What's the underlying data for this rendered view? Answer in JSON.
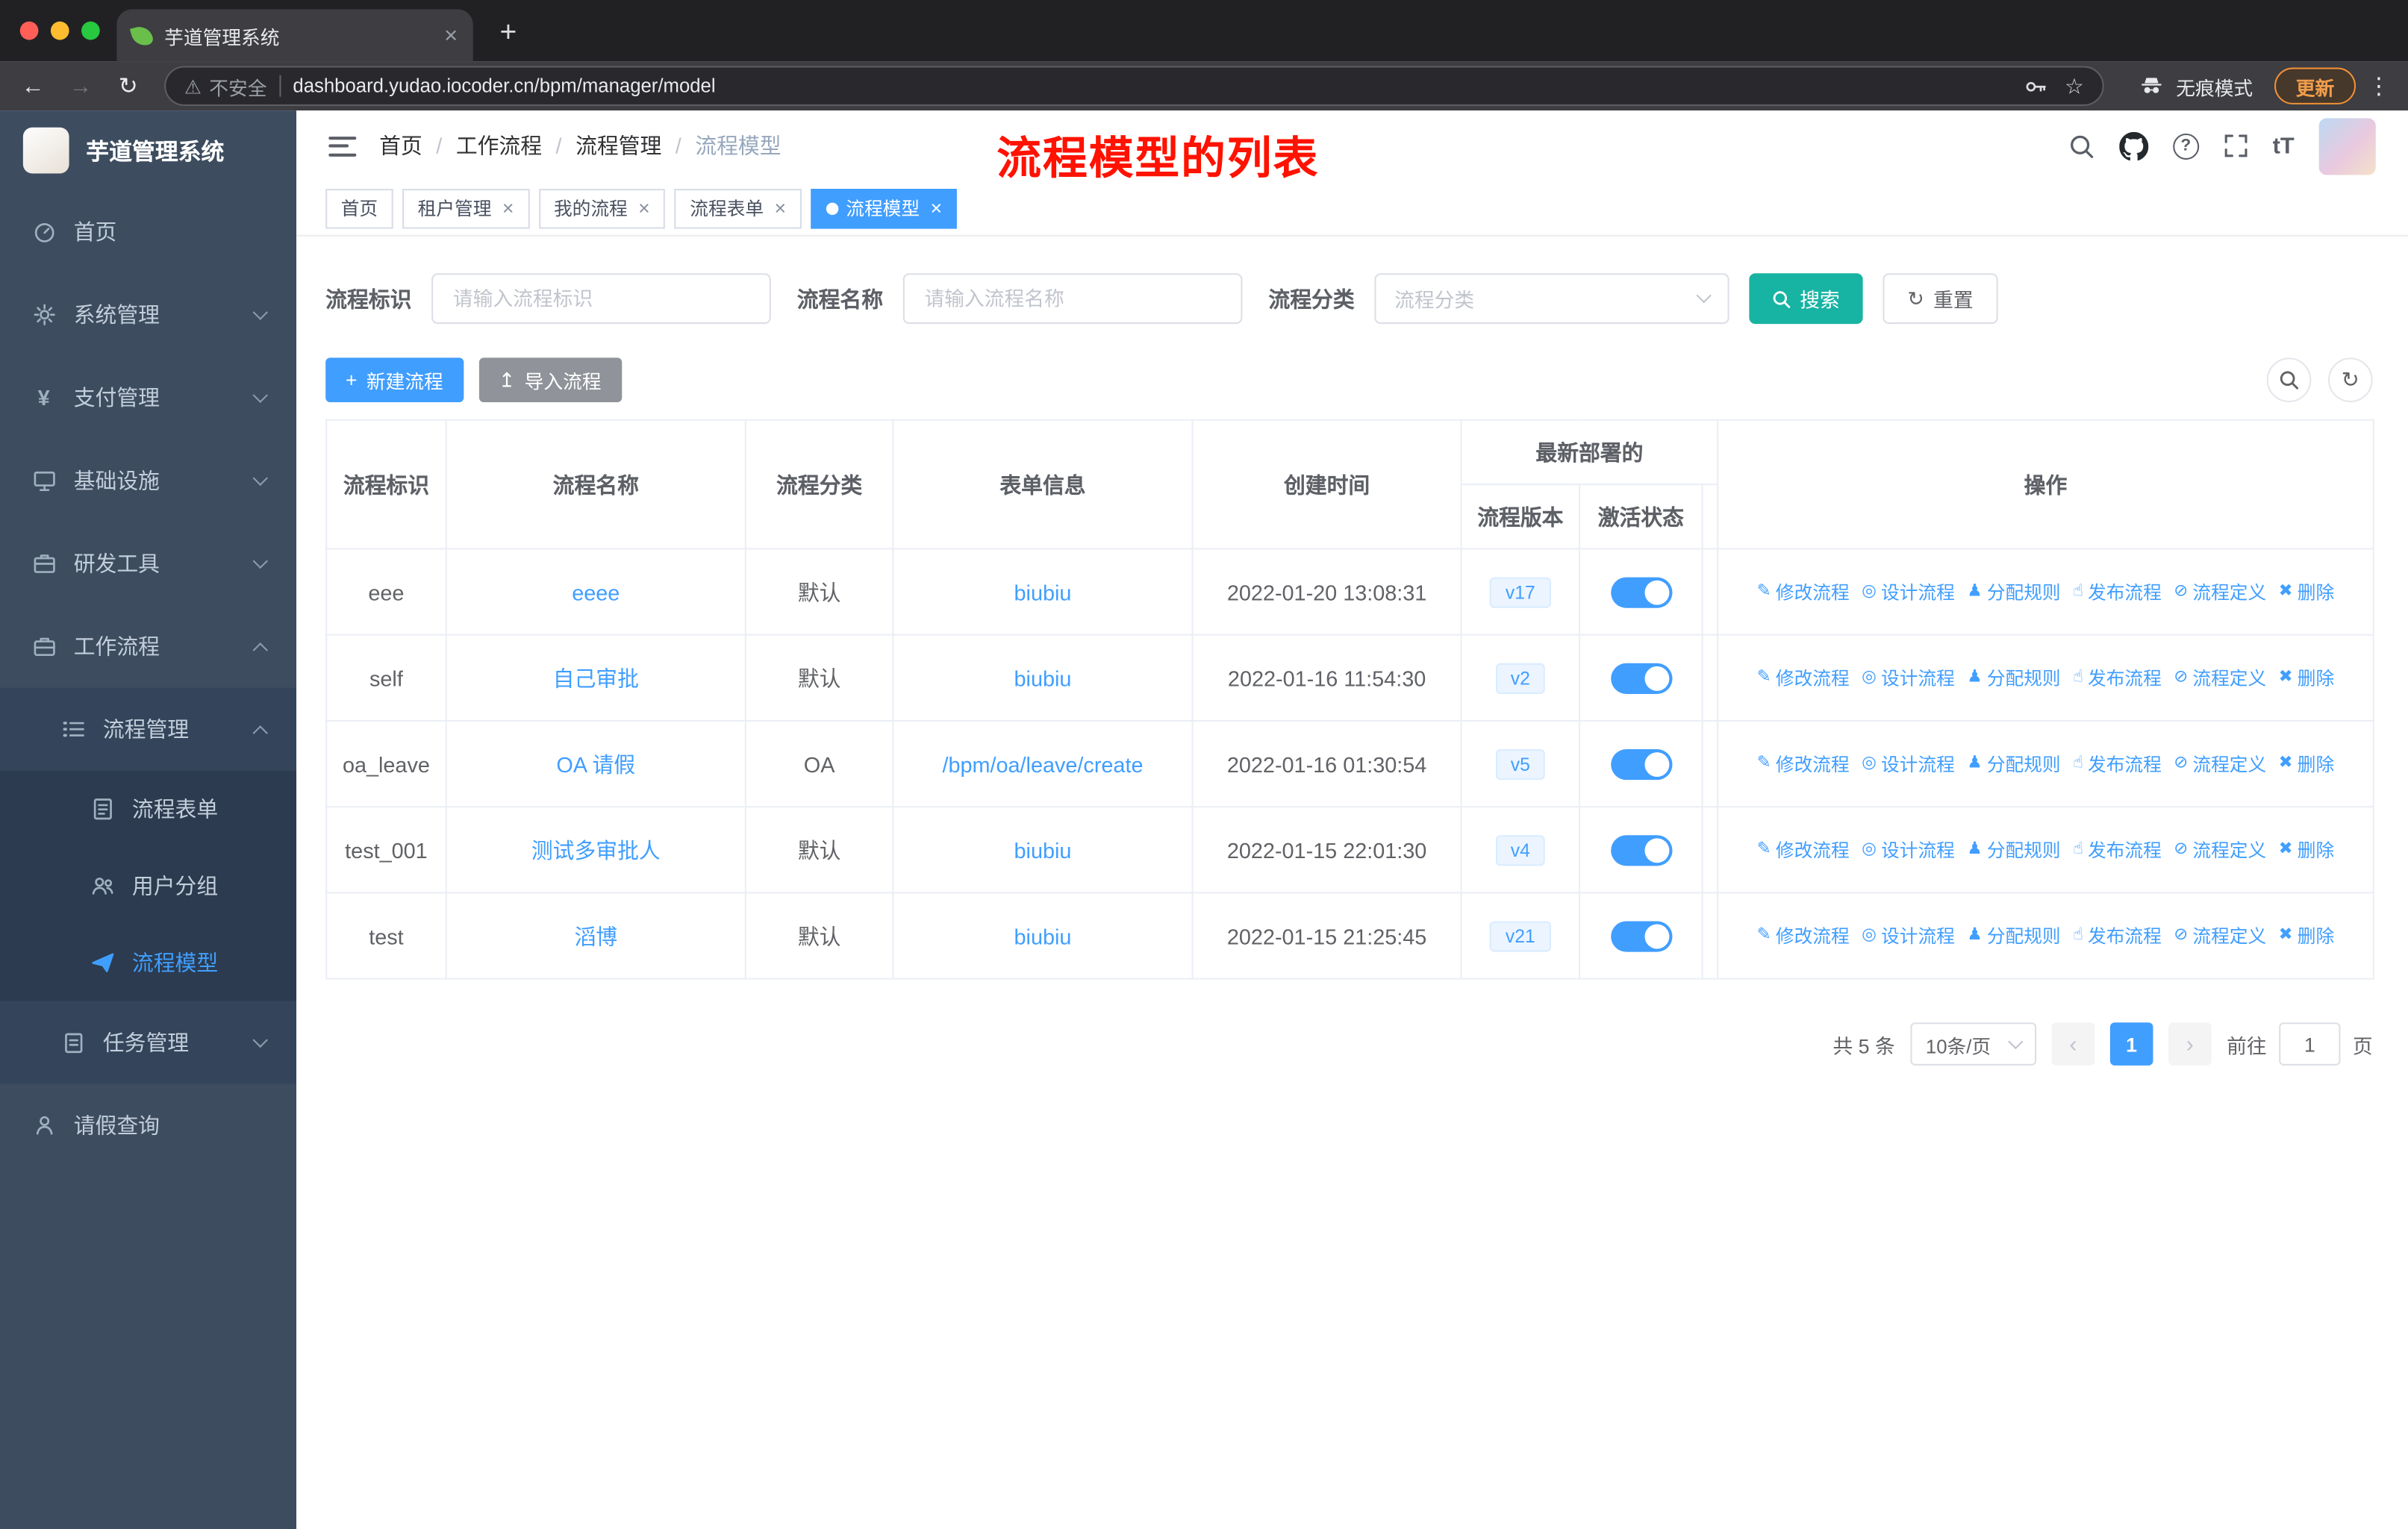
{
  "browser": {
    "tab_title": "芋道管理系统",
    "security_label": "不安全",
    "url": "dashboard.yudao.iocoder.cn/bpm/manager/model",
    "incognito_label": "无痕模式",
    "update_label": "更新"
  },
  "icons": {
    "tab_close": "×",
    "new_tab": "+",
    "back": "←",
    "forward": "→",
    "reload": "↻",
    "warning": "⚠",
    "star": "☆",
    "more": "⋮",
    "yen": "¥",
    "question": "?",
    "font_size": "tT",
    "plus": "+",
    "upload": "↥",
    "refresh": "↻",
    "prev": "‹",
    "next": "›",
    "action_edit": "✎",
    "action_design": "◎",
    "action_assign": "♟",
    "action_publish": "☝",
    "action_define": "⊘",
    "action_delete": "✖"
  },
  "sidebar": {
    "logo_title": "芋道管理系统",
    "home": "首页",
    "system": "系统管理",
    "payment": "支付管理",
    "infra": "基础设施",
    "devtools": "研发工具",
    "workflow": "工作流程",
    "process_mgmt": "流程管理",
    "process_form": "流程表单",
    "user_group": "用户分组",
    "process_model": "流程模型",
    "task_mgmt": "任务管理",
    "leave_query": "请假查询"
  },
  "header": {
    "breadcrumb": [
      "首页",
      "工作流程",
      "流程管理",
      "流程模型"
    ],
    "separator": "/",
    "annotation": "流程模型的列表"
  },
  "tags": [
    {
      "label": "首页"
    },
    {
      "label": "租户管理"
    },
    {
      "label": "我的流程"
    },
    {
      "label": "流程表单"
    },
    {
      "label": "流程模型"
    }
  ],
  "filters": {
    "id_label": "流程标识",
    "id_placeholder": "请输入流程标识",
    "name_label": "流程名称",
    "name_placeholder": "请输入流程名称",
    "category_label": "流程分类",
    "category_placeholder": "流程分类",
    "search_label": "搜索",
    "reset_label": "重置"
  },
  "toolbar": {
    "create_label": "新建流程",
    "import_label": "导入流程"
  },
  "table": {
    "headers": {
      "id": "流程标识",
      "name": "流程名称",
      "category": "流程分类",
      "form": "表单信息",
      "created": "创建时间",
      "deploy_group": "最新部署的",
      "version": "流程版本",
      "active": "激活状态",
      "actions": "操作"
    },
    "actions": [
      "修改流程",
      "设计流程",
      "分配规则",
      "发布流程",
      "流程定义",
      "删除"
    ],
    "rows": [
      {
        "id": "eee",
        "name": "eeee",
        "category": "默认",
        "form": "biubiu",
        "created": "2022-01-20 13:08:31",
        "version": "v17",
        "active": true
      },
      {
        "id": "self",
        "name": "自己审批",
        "category": "默认",
        "form": "biubiu",
        "created": "2022-01-16 11:54:30",
        "version": "v2",
        "active": true
      },
      {
        "id": "oa_leave",
        "name": "OA 请假",
        "category": "OA",
        "form": "/bpm/oa/leave/create",
        "created": "2022-01-16 01:30:54",
        "version": "v5",
        "active": true
      },
      {
        "id": "test_001",
        "name": "测试多审批人",
        "category": "默认",
        "form": "biubiu",
        "created": "2022-01-15 22:01:30",
        "version": "v4",
        "active": true
      },
      {
        "id": "test",
        "name": "滔博",
        "category": "默认",
        "form": "biubiu",
        "created": "2022-01-15 21:25:45",
        "version": "v21",
        "active": true
      }
    ]
  },
  "pagination": {
    "total": "共 5 条",
    "page_size": "10条/页",
    "current_page": "1",
    "goto_label": "前往",
    "goto_value": "1",
    "page_unit": "页"
  },
  "colors": {
    "primary": "#409eff",
    "search_button": "#17b3a3",
    "import_button": "#909399",
    "annotation_red": "#ff1200",
    "sidebar_bg": "#3d4c5f",
    "active_tag": "#409eff"
  }
}
